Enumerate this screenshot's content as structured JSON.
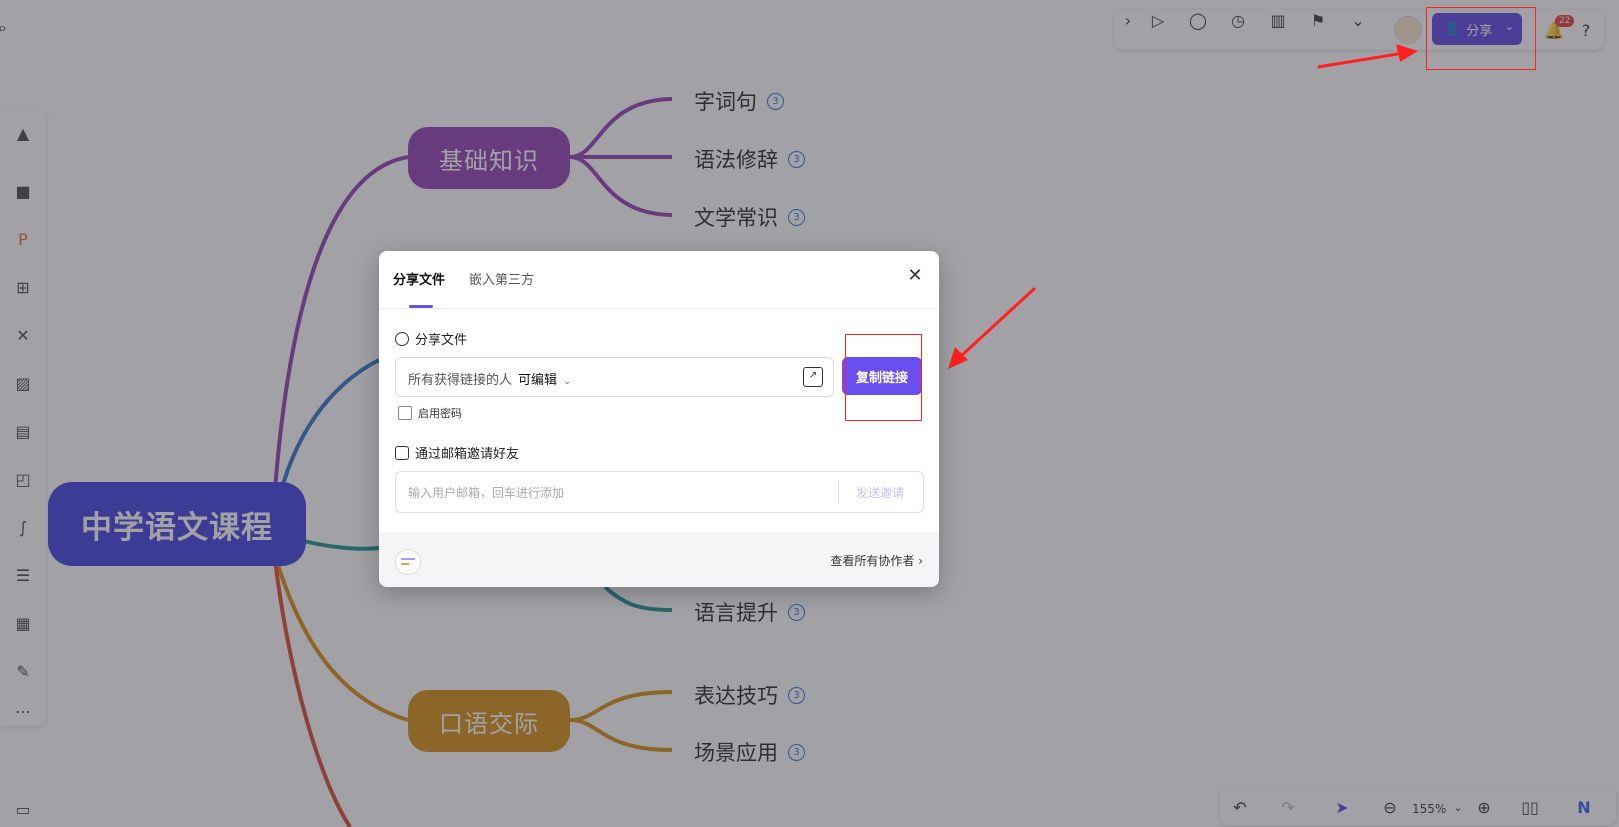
{
  "mindmap": {
    "root": "中学语文课程",
    "branches": {
      "basics": "基础知识",
      "oral": "口语交际"
    },
    "leaves": {
      "words": "字词句",
      "grammar": "语法修辞",
      "literature": "文学常识",
      "language_up": "语言提升",
      "expression": "表达技巧",
      "scenario": "场景应用"
    },
    "leaf_count": "3",
    "colors": {
      "root": "#3d3de0",
      "basics": "#8e3bb0",
      "oral": "#d58a10",
      "blue_line": "#2f6fc8",
      "teal_line": "#168f8f",
      "red_line": "#d9442e"
    }
  },
  "toolbar": {
    "share_label": "分享",
    "notification_count": "22"
  },
  "bottom": {
    "zoom": "155%"
  },
  "dialog": {
    "tabs": [
      "分享文件",
      "嵌入第三方"
    ],
    "section_share": "分享文件",
    "link_scope": "所有获得链接的人",
    "link_permission": "可编辑",
    "copy_link": "复制链接",
    "password_label": "启用密码",
    "section_invite": "通过邮箱邀请好友",
    "email_placeholder": "输入用户邮箱，回车进行添加",
    "send_invite": "发送邀请",
    "view_collaborators": "查看所有协作者"
  },
  "theme": {
    "accent": "#6b4ef0",
    "share_button": "#5b3fe0",
    "annotation_red": "#ff2020"
  }
}
